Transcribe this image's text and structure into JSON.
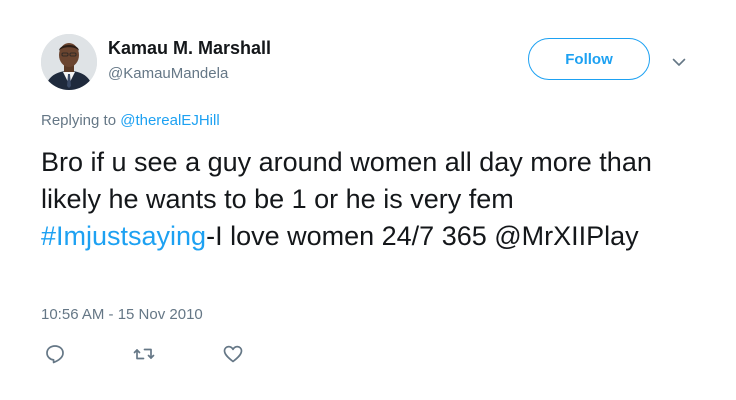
{
  "author": {
    "display_name": "Kamau M. Marshall",
    "handle": "@KamauMandela",
    "avatar_icon": "profile-photo"
  },
  "follow_button": {
    "label": "Follow"
  },
  "menu": {
    "icon": "chevron-down-icon"
  },
  "reply_context": {
    "prefix": "Replying to ",
    "mention": "@therealEJHill"
  },
  "tweet": {
    "text_part1": "Bro if u see a guy around women all day more than likely he wants to be 1 or he is very fem ",
    "hashtag": "#Imjustsaying",
    "text_part2": "-I love women 24/7 365 @MrXIIPlay"
  },
  "timestamp": "10:56 AM - 15 Nov 2010",
  "actions": {
    "reply_icon": "reply-icon",
    "retweet_icon": "retweet-icon",
    "like_icon": "heart-icon"
  },
  "colors": {
    "accent": "#1da1f2",
    "text": "#14171a",
    "secondary": "#657786",
    "background": "#ffffff"
  }
}
